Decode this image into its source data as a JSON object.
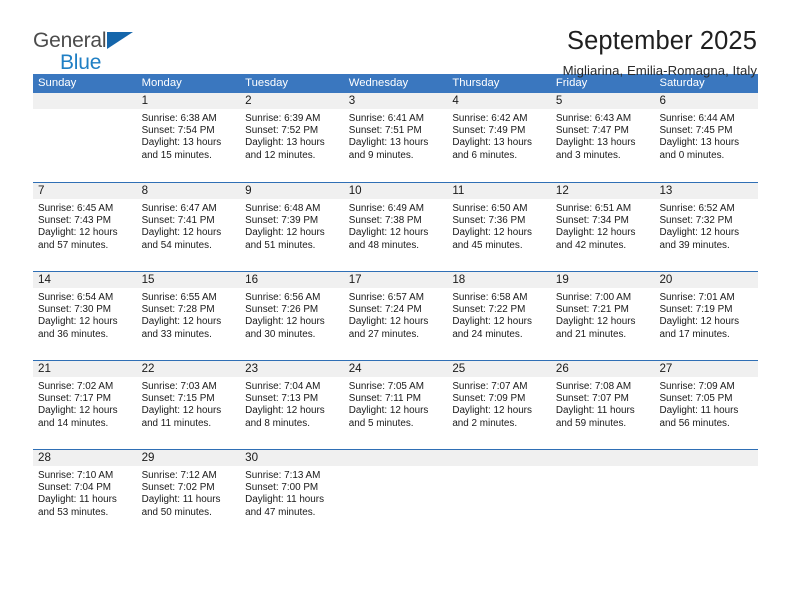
{
  "brand": {
    "name_part1": "General",
    "name_part2": "Blue",
    "triangle_color": "#1566ab",
    "blue_color": "#1f7fc4"
  },
  "header": {
    "month_title": "September 2025",
    "location": "Migliarina, Emilia-Romagna, Italy"
  },
  "theme": {
    "header_blue": "#3a77bf",
    "divider_blue": "#2f6fb5",
    "daynum_band": "#f0f0f0",
    "page_background": "#ffffff"
  },
  "weekday_headers": [
    "Sunday",
    "Monday",
    "Tuesday",
    "Wednesday",
    "Thursday",
    "Friday",
    "Saturday"
  ],
  "weeks": [
    [
      {
        "day": "",
        "sunrise": "",
        "sunset": "",
        "daylight_line1": "",
        "daylight_line2": ""
      },
      {
        "day": "1",
        "sunrise": "Sunrise: 6:38 AM",
        "sunset": "Sunset: 7:54 PM",
        "daylight_line1": "Daylight: 13 hours",
        "daylight_line2": "and 15 minutes."
      },
      {
        "day": "2",
        "sunrise": "Sunrise: 6:39 AM",
        "sunset": "Sunset: 7:52 PM",
        "daylight_line1": "Daylight: 13 hours",
        "daylight_line2": "and 12 minutes."
      },
      {
        "day": "3",
        "sunrise": "Sunrise: 6:41 AM",
        "sunset": "Sunset: 7:51 PM",
        "daylight_line1": "Daylight: 13 hours",
        "daylight_line2": "and 9 minutes."
      },
      {
        "day": "4",
        "sunrise": "Sunrise: 6:42 AM",
        "sunset": "Sunset: 7:49 PM",
        "daylight_line1": "Daylight: 13 hours",
        "daylight_line2": "and 6 minutes."
      },
      {
        "day": "5",
        "sunrise": "Sunrise: 6:43 AM",
        "sunset": "Sunset: 7:47 PM",
        "daylight_line1": "Daylight: 13 hours",
        "daylight_line2": "and 3 minutes."
      },
      {
        "day": "6",
        "sunrise": "Sunrise: 6:44 AM",
        "sunset": "Sunset: 7:45 PM",
        "daylight_line1": "Daylight: 13 hours",
        "daylight_line2": "and 0 minutes."
      }
    ],
    [
      {
        "day": "7",
        "sunrise": "Sunrise: 6:45 AM",
        "sunset": "Sunset: 7:43 PM",
        "daylight_line1": "Daylight: 12 hours",
        "daylight_line2": "and 57 minutes."
      },
      {
        "day": "8",
        "sunrise": "Sunrise: 6:47 AM",
        "sunset": "Sunset: 7:41 PM",
        "daylight_line1": "Daylight: 12 hours",
        "daylight_line2": "and 54 minutes."
      },
      {
        "day": "9",
        "sunrise": "Sunrise: 6:48 AM",
        "sunset": "Sunset: 7:39 PM",
        "daylight_line1": "Daylight: 12 hours",
        "daylight_line2": "and 51 minutes."
      },
      {
        "day": "10",
        "sunrise": "Sunrise: 6:49 AM",
        "sunset": "Sunset: 7:38 PM",
        "daylight_line1": "Daylight: 12 hours",
        "daylight_line2": "and 48 minutes."
      },
      {
        "day": "11",
        "sunrise": "Sunrise: 6:50 AM",
        "sunset": "Sunset: 7:36 PM",
        "daylight_line1": "Daylight: 12 hours",
        "daylight_line2": "and 45 minutes."
      },
      {
        "day": "12",
        "sunrise": "Sunrise: 6:51 AM",
        "sunset": "Sunset: 7:34 PM",
        "daylight_line1": "Daylight: 12 hours",
        "daylight_line2": "and 42 minutes."
      },
      {
        "day": "13",
        "sunrise": "Sunrise: 6:52 AM",
        "sunset": "Sunset: 7:32 PM",
        "daylight_line1": "Daylight: 12 hours",
        "daylight_line2": "and 39 minutes."
      }
    ],
    [
      {
        "day": "14",
        "sunrise": "Sunrise: 6:54 AM",
        "sunset": "Sunset: 7:30 PM",
        "daylight_line1": "Daylight: 12 hours",
        "daylight_line2": "and 36 minutes."
      },
      {
        "day": "15",
        "sunrise": "Sunrise: 6:55 AM",
        "sunset": "Sunset: 7:28 PM",
        "daylight_line1": "Daylight: 12 hours",
        "daylight_line2": "and 33 minutes."
      },
      {
        "day": "16",
        "sunrise": "Sunrise: 6:56 AM",
        "sunset": "Sunset: 7:26 PM",
        "daylight_line1": "Daylight: 12 hours",
        "daylight_line2": "and 30 minutes."
      },
      {
        "day": "17",
        "sunrise": "Sunrise: 6:57 AM",
        "sunset": "Sunset: 7:24 PM",
        "daylight_line1": "Daylight: 12 hours",
        "daylight_line2": "and 27 minutes."
      },
      {
        "day": "18",
        "sunrise": "Sunrise: 6:58 AM",
        "sunset": "Sunset: 7:22 PM",
        "daylight_line1": "Daylight: 12 hours",
        "daylight_line2": "and 24 minutes."
      },
      {
        "day": "19",
        "sunrise": "Sunrise: 7:00 AM",
        "sunset": "Sunset: 7:21 PM",
        "daylight_line1": "Daylight: 12 hours",
        "daylight_line2": "and 21 minutes."
      },
      {
        "day": "20",
        "sunrise": "Sunrise: 7:01 AM",
        "sunset": "Sunset: 7:19 PM",
        "daylight_line1": "Daylight: 12 hours",
        "daylight_line2": "and 17 minutes."
      }
    ],
    [
      {
        "day": "21",
        "sunrise": "Sunrise: 7:02 AM",
        "sunset": "Sunset: 7:17 PM",
        "daylight_line1": "Daylight: 12 hours",
        "daylight_line2": "and 14 minutes."
      },
      {
        "day": "22",
        "sunrise": "Sunrise: 7:03 AM",
        "sunset": "Sunset: 7:15 PM",
        "daylight_line1": "Daylight: 12 hours",
        "daylight_line2": "and 11 minutes."
      },
      {
        "day": "23",
        "sunrise": "Sunrise: 7:04 AM",
        "sunset": "Sunset: 7:13 PM",
        "daylight_line1": "Daylight: 12 hours",
        "daylight_line2": "and 8 minutes."
      },
      {
        "day": "24",
        "sunrise": "Sunrise: 7:05 AM",
        "sunset": "Sunset: 7:11 PM",
        "daylight_line1": "Daylight: 12 hours",
        "daylight_line2": "and 5 minutes."
      },
      {
        "day": "25",
        "sunrise": "Sunrise: 7:07 AM",
        "sunset": "Sunset: 7:09 PM",
        "daylight_line1": "Daylight: 12 hours",
        "daylight_line2": "and 2 minutes."
      },
      {
        "day": "26",
        "sunrise": "Sunrise: 7:08 AM",
        "sunset": "Sunset: 7:07 PM",
        "daylight_line1": "Daylight: 11 hours",
        "daylight_line2": "and 59 minutes."
      },
      {
        "day": "27",
        "sunrise": "Sunrise: 7:09 AM",
        "sunset": "Sunset: 7:05 PM",
        "daylight_line1": "Daylight: 11 hours",
        "daylight_line2": "and 56 minutes."
      }
    ],
    [
      {
        "day": "28",
        "sunrise": "Sunrise: 7:10 AM",
        "sunset": "Sunset: 7:04 PM",
        "daylight_line1": "Daylight: 11 hours",
        "daylight_line2": "and 53 minutes."
      },
      {
        "day": "29",
        "sunrise": "Sunrise: 7:12 AM",
        "sunset": "Sunset: 7:02 PM",
        "daylight_line1": "Daylight: 11 hours",
        "daylight_line2": "and 50 minutes."
      },
      {
        "day": "30",
        "sunrise": "Sunrise: 7:13 AM",
        "sunset": "Sunset: 7:00 PM",
        "daylight_line1": "Daylight: 11 hours",
        "daylight_line2": "and 47 minutes."
      },
      {
        "day": "",
        "sunrise": "",
        "sunset": "",
        "daylight_line1": "",
        "daylight_line2": ""
      },
      {
        "day": "",
        "sunrise": "",
        "sunset": "",
        "daylight_line1": "",
        "daylight_line2": ""
      },
      {
        "day": "",
        "sunrise": "",
        "sunset": "",
        "daylight_line1": "",
        "daylight_line2": ""
      },
      {
        "day": "",
        "sunrise": "",
        "sunset": "",
        "daylight_line1": "",
        "daylight_line2": ""
      }
    ]
  ]
}
